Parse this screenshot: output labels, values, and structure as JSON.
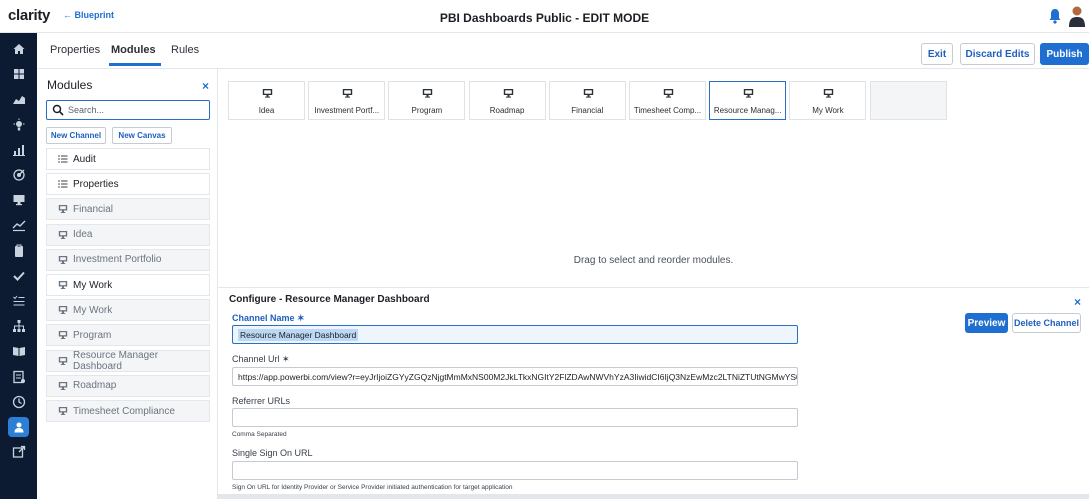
{
  "header": {
    "logo": "clarity",
    "back_link": "← Blueprint",
    "title": "PBI Dashboards Public - EDIT MODE",
    "accent": "#1f6fd1"
  },
  "leftnav": {
    "icons": [
      "home-icon",
      "grid-icon",
      "chart-icon",
      "idea-icon",
      "bar-chart-icon",
      "target-icon",
      "monitor-icon",
      "trend-icon",
      "clipboard-icon",
      "check-icon",
      "checklist-icon",
      "org-icon",
      "book-icon",
      "report-icon",
      "clock-icon",
      "admin-icon",
      "export-icon"
    ],
    "active_index": 15,
    "background": "#0c1b31"
  },
  "tabs": {
    "items": [
      "Properties",
      "Modules",
      "Rules"
    ],
    "active": "Modules"
  },
  "actions": {
    "exit": "Exit",
    "discard": "Discard Edits",
    "publish": "Publish"
  },
  "modules_panel": {
    "title": "Modules",
    "close": "×",
    "search_placeholder": "Search...",
    "new_channel": "New Channel",
    "new_canvas": "New Canvas",
    "items": [
      {
        "label": "Audit",
        "icon": "list-icon",
        "style": "white"
      },
      {
        "label": "Properties",
        "icon": "list-icon",
        "style": "white"
      },
      {
        "label": "Financial",
        "icon": "monitor-icon",
        "style": "gray"
      },
      {
        "label": "Idea",
        "icon": "monitor-icon",
        "style": "gray"
      },
      {
        "label": "Investment Portfolio",
        "icon": "monitor-icon",
        "style": "gray"
      },
      {
        "label": "My Work",
        "icon": "monitor-icon",
        "style": "white"
      },
      {
        "label": "My Work",
        "icon": "monitor-icon",
        "style": "gray"
      },
      {
        "label": "Program",
        "icon": "monitor-icon",
        "style": "gray"
      },
      {
        "label": "Resource Manager Dashboard",
        "icon": "monitor-icon",
        "style": "gray"
      },
      {
        "label": "Roadmap",
        "icon": "monitor-icon",
        "style": "gray"
      },
      {
        "label": "Timesheet Compliance",
        "icon": "monitor-icon",
        "style": "gray"
      }
    ]
  },
  "canvas": {
    "cards": [
      "Idea",
      "Investment Portf...",
      "Program",
      "Roadmap",
      "Financial",
      "Timesheet Comp...",
      "Resource Manag...",
      "My Work",
      ""
    ],
    "selected_index": 6,
    "hint": "Drag to select and reorder modules."
  },
  "configure": {
    "title": "Configure - Resource Manager Dashboard",
    "close": "×",
    "preview": "Preview",
    "delete": "Delete Channel",
    "channel_name_label": "Channel Name ✶",
    "channel_name_value": "Resource Manager Dashboard",
    "channel_url_label": "Channel Url ✶",
    "channel_url_value": "https://app.powerbi.com/view?r=eyJrIjoiZGYyZGQzNjgtMmMxNS00M2JkLTkxNGItY2FlZDAwNWVhYzA3IiwidCI6IjQ3NzEwMzc2LTNiZTUtNGMwYS04Yj...",
    "referrer_label": "Referrer URLs",
    "referrer_value": "",
    "referrer_hint": "Comma Separated",
    "sso_label": "Single Sign On URL",
    "sso_value": "",
    "sso_hint": "Sign On URL for Identity Provider or Service Provider initiated authentication for target application"
  }
}
